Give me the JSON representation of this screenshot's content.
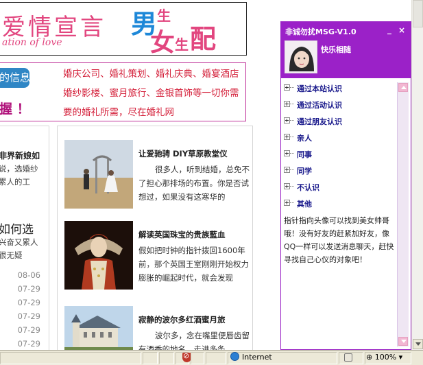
{
  "banner": {
    "title": "爱情宣言",
    "subtitle": "ation of love",
    "logo_main_1": "男",
    "logo_small_1": "生",
    "logo_main_2": "女",
    "logo_small_2": "生",
    "logo_main_3": "配"
  },
  "ad": {
    "pill_text": "的信息",
    "big_text": "握 ！",
    "lines": [
      "婚庆公司、婚礼策划、婚礼庆典、婚宴酒店",
      "婚纱影楼、蜜月旅行、金银首饰等一切你需",
      "要的婚礼所需，尽在婚礼网"
    ]
  },
  "left_col": {
    "title": "非界新娘如",
    "text_1": "说，选婚纱",
    "text_2": "累人的工",
    "big": "如何选",
    "text_3": "兴奋又累人",
    "text_4": "很无疑",
    "dates": [
      "08-06",
      "07-29",
      "07-29",
      "07-29",
      "07-29",
      "07-29",
      "07-29"
    ]
  },
  "articles": [
    {
      "title": "让爱驰骋 DIY草原教堂仪",
      "body": "很多人，听到结婚，总免不了担心那排场的布置。你是否试想过，如果没有这寒华的"
    },
    {
      "title": "解读英国珠宝的贵族藍血",
      "body": "假如把时钟的指针拨回1600年前，那个英国王室刚刚开始权力膨胀的崛起时代，就会发现"
    },
    {
      "title": "寂静的波尔多红酒蜜月旅",
      "body": "波尔多，念在嘴里便唇齿留有酒香的地名，走进多条"
    }
  ],
  "msg": {
    "title": "非诚勿扰MSG-V1.0",
    "minimize": "_",
    "close": "×",
    "name": "快乐相随",
    "tree": [
      "通过本站认识",
      "通过活动认识",
      "通过朋友认识",
      "亲人",
      "同事",
      "同学",
      "不认识",
      "其他"
    ],
    "text": "指针指向头像可以找到美女帅哥哦！没有好友的赶紧加好友，像QQ一样可以发送消息聊天，赶快寻找自己心仪的对象吧！"
  },
  "status": {
    "zone": "Internet",
    "zoom": "100%"
  },
  "colors": {
    "purple": "#9b21c8",
    "pink": "#e2467f",
    "ad_red": "#d4203a",
    "link_blue": "#1a1a8c"
  }
}
